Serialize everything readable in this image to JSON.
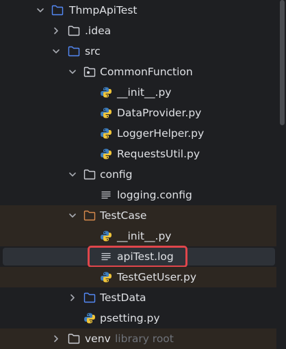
{
  "project_tree": {
    "root": {
      "name": "ThmpApiTest",
      "expanded": true
    },
    "idea": {
      "name": ".idea",
      "expanded": false
    },
    "src": {
      "name": "src",
      "expanded": true
    },
    "common_function": {
      "name": "CommonFunction",
      "expanded": true,
      "files": [
        "__init__.py",
        "DataProvider.py",
        "LoggerHelper.py",
        "RequestsUtil.py"
      ]
    },
    "config": {
      "name": "config",
      "expanded": true,
      "files": [
        "logging.config"
      ]
    },
    "test_case": {
      "name": "TestCase",
      "expanded": true,
      "files": [
        "__init__.py",
        "apiTest.log",
        "TestGetUser.py"
      ],
      "selected_file": "apiTest.log"
    },
    "test_data": {
      "name": "TestData",
      "expanded": false
    },
    "psetting": {
      "name": "psetting.py"
    },
    "venv": {
      "name": "venv",
      "meta": "library root",
      "expanded": false
    }
  },
  "colors": {
    "background": "#1e1f22",
    "selection": "#2e3238",
    "excluded_tint": "#2d2721",
    "highlight_box": "#e0464b",
    "folder_blue": "#548af7",
    "folder_gray": "#ced0d6",
    "folder_orange": "#d88a4c",
    "python_blue": "#3d7ebf",
    "python_yellow": "#f0c53a",
    "text": "#dfe1e5",
    "muted_text": "#6f737a"
  }
}
